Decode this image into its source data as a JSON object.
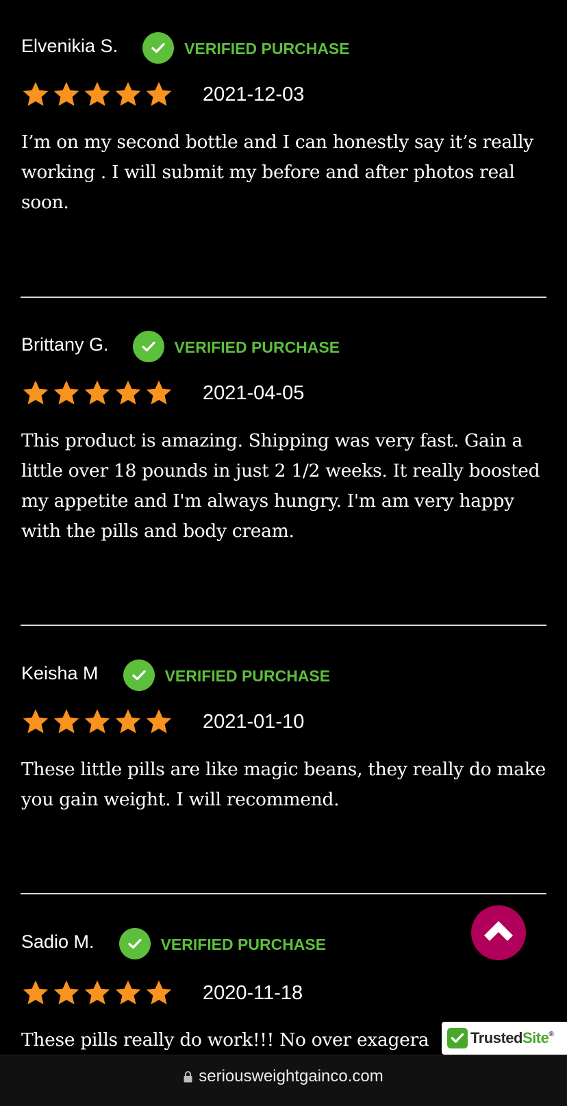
{
  "reviews": [
    {
      "name": "Elvenikia S.",
      "verified_label": "VERIFIED PURCHASE",
      "rating": 5,
      "date": "2021-12-03",
      "text": "I’m on my second bottle and I can honestly say it’s really working . I will submit my before and after photos real soon."
    },
    {
      "name": "Brittany G.",
      "verified_label": "VERIFIED PURCHASE",
      "rating": 5,
      "date": "2021-04-05",
      "text": "This product is amazing. Shipping was very fast. Gain a little over 18 pounds in just 2 1/2 weeks. It really boosted my appetite and I'm always hungry. I'm am very happy with the pills and body cream."
    },
    {
      "name": "Keisha M",
      "verified_label": "VERIFIED PURCHASE",
      "rating": 5,
      "date": "2021-01-10",
      "text": "These little pills are like magic beans, they really do make you gain weight. I will recommend."
    },
    {
      "name": "Sadio M.",
      "verified_label": "VERIFIED PURCHASE",
      "rating": 5,
      "date": "2020-11-18",
      "text": "These pills really do work!!! No over exagera"
    }
  ],
  "trusted_badge": {
    "trusted": "Trusted",
    "site": "Site",
    "mark": "®"
  },
  "browser": {
    "url": "seriousweightgainco.com",
    "lock_icon": "lock-icon"
  },
  "scroll_top": {
    "icon": "chevron-up-icon"
  },
  "colors": {
    "background": "#000000",
    "verified_green": "#5dbf3c",
    "star_orange": "#f7931e",
    "scroll_top_magenta": "#b1005a",
    "divider": "#d9d9d9"
  }
}
